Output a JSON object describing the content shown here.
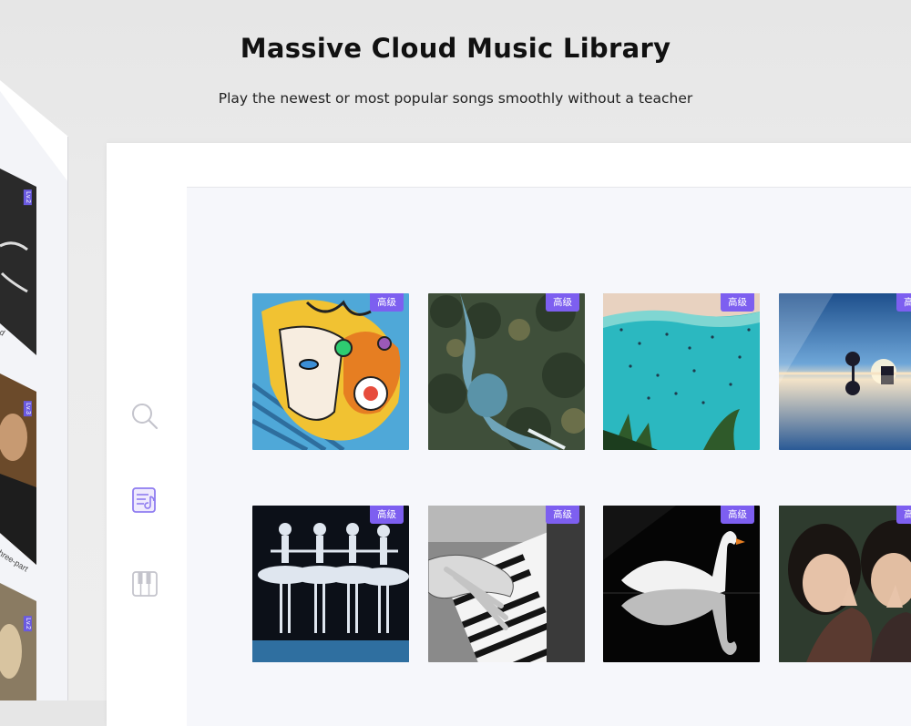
{
  "header": {
    "title": "Massive Cloud Music Library",
    "subtitle": "Play the newest or most popular songs smoothly without a teacher"
  },
  "side_panel": {
    "cards": [
      {
        "badge": "Lv.2",
        "caption": "d"
      },
      {
        "badge": "Lv.3",
        "caption": "three-part"
      },
      {
        "badge": "Lv.2",
        "caption": ""
      }
    ]
  },
  "sidebar": {
    "items": [
      {
        "icon": "search-icon"
      },
      {
        "icon": "music-sheet-icon",
        "active": true
      },
      {
        "icon": "piano-keys-icon"
      }
    ]
  },
  "library": {
    "tiles": [
      {
        "badge": "高级",
        "art": "colorful-illustration-face"
      },
      {
        "badge": "高级",
        "art": "aerial-river-forest"
      },
      {
        "badge": "高级",
        "art": "beach-with-swimmers"
      },
      {
        "badge": "高级",
        "art": "sky-reflection-tree"
      },
      {
        "badge": "高级",
        "art": "ballet-dancers"
      },
      {
        "badge": "高级",
        "art": "hands-on-piano"
      },
      {
        "badge": "高级",
        "art": "swan-reflection"
      },
      {
        "badge": "高级",
        "art": "couple-praying"
      }
    ]
  },
  "colors": {
    "accent": "#7d5ff0",
    "active_icon": "#8f7cf0",
    "inactive_icon": "#c4c4cc"
  }
}
